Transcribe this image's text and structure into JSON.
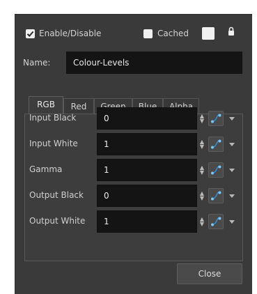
{
  "header": {
    "enable_label": "Enable/Disable",
    "enable_checked": true,
    "cached_label": "Cached",
    "cached_checked": false
  },
  "name": {
    "label": "Name:",
    "value": "Colour-Levels"
  },
  "tabs": [
    {
      "label": "RGB",
      "active": true
    },
    {
      "label": "Red",
      "active": false
    },
    {
      "label": "Green",
      "active": false
    },
    {
      "label": "Blue",
      "active": false
    },
    {
      "label": "Alpha",
      "active": false
    }
  ],
  "params": [
    {
      "label": "Input Black",
      "value": "0"
    },
    {
      "label": "Input White",
      "value": "1"
    },
    {
      "label": "Gamma",
      "value": "1"
    },
    {
      "label": "Output Black",
      "value": "0"
    },
    {
      "label": "Output White",
      "value": "1"
    }
  ],
  "footer": {
    "close_label": "Close"
  },
  "colors": {
    "dialog_bg": "#3a3a3a",
    "field_bg": "#141414",
    "accent_blue": "#2f8fd6"
  }
}
